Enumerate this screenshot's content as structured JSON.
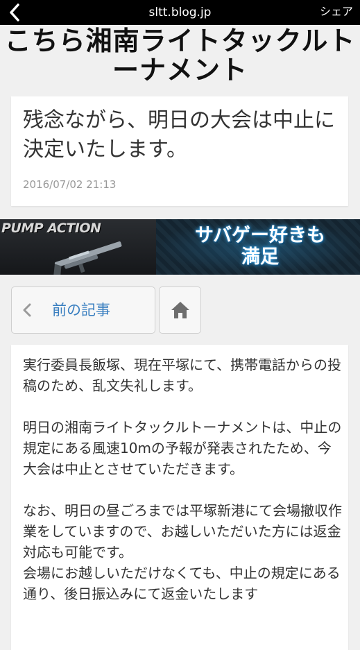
{
  "browser": {
    "url": "sltt.blog.jp",
    "share_label": "シェア"
  },
  "blog": {
    "title": "こちら湘南ライトタックルトーナメント"
  },
  "post": {
    "title": "残念ながら、明日の大会は中止に決定いたします。",
    "date": "2016/07/02 21:13"
  },
  "banner": {
    "brand": "PUMP ACTION",
    "tagline_line1": "サバゲー好きも",
    "tagline_line2": "満足"
  },
  "nav": {
    "prev_label": "前の記事"
  },
  "body": {
    "paragraphs": [
      "実行委員長飯塚、現在平塚にて、携帯電話からの投稿のため、乱文失礼します。",
      "明日の湘南ライトタックルトーナメントは、中止の規定にある風速10mの予報が発表されたため、今大会は中止とさせていただきます。",
      "なお、明日の昼ごろまでは平塚新港にて会場撤収作業をしていますので、お越しいただいた方には返金対応も可能です。",
      "会場にお越しいただけなくても、中止の規定にある通り、後日振込みにて返金いたします"
    ]
  },
  "icons": {
    "back": "chevron-left-icon",
    "prev": "chevron-left-icon",
    "home": "home-icon"
  }
}
